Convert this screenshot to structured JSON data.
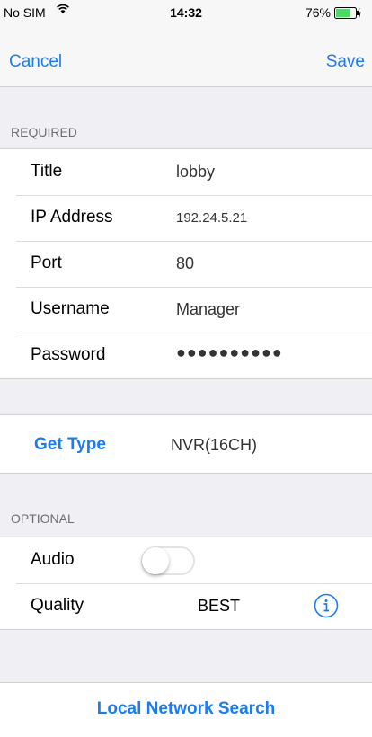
{
  "status_bar": {
    "carrier": "No SIM",
    "time": "14:32",
    "battery": "76%",
    "battery_level": 0.76
  },
  "nav": {
    "cancel_label": "Cancel",
    "save_label": "Save"
  },
  "required": {
    "header": "REQUIRED",
    "fields": [
      {
        "label": "Title",
        "value": "lobby"
      },
      {
        "label": "IP Address",
        "value": "192.24.5.21"
      },
      {
        "label": "Port",
        "value": "80"
      },
      {
        "label": "Username",
        "value": "Manager"
      },
      {
        "label": "Password",
        "value": "●●●●●●●●●●"
      }
    ]
  },
  "get_type": {
    "label": "Get Type",
    "value": "NVR(16CH)"
  },
  "optional": {
    "header": "OPTIONAL",
    "audio_label": "Audio",
    "audio_on": false,
    "quality_label": "Quality",
    "quality_value": "BEST"
  },
  "local_search_label": "Local Network Search",
  "colors": {
    "accent": "#1a7cf5",
    "background": "#efeff4"
  },
  "icons": [
    "wifi-icon",
    "battery-icon",
    "info-icon"
  ]
}
